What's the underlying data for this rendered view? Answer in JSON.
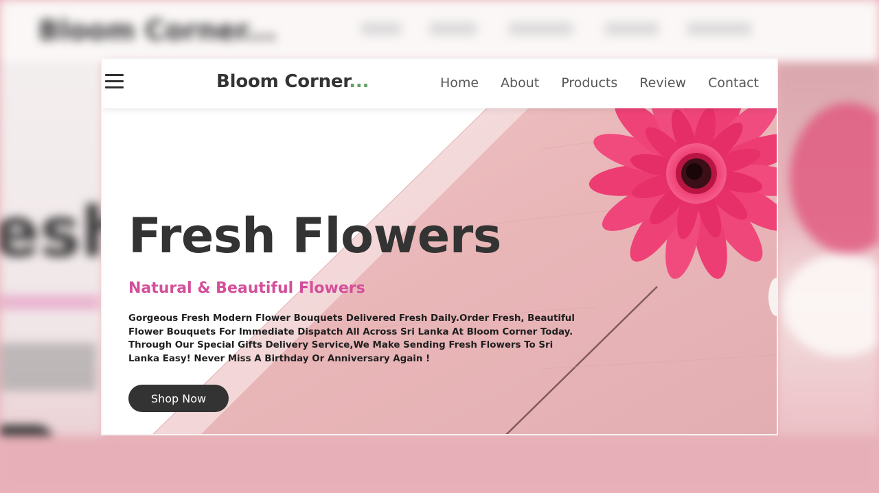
{
  "background": {
    "brand_text": "Bloom Corner..."
  },
  "header": {
    "brand_name": "Bloom Corner",
    "brand_suffix": "...",
    "nav": [
      {
        "label": "Home"
      },
      {
        "label": "About"
      },
      {
        "label": "Products"
      },
      {
        "label": "Review"
      },
      {
        "label": "Contact"
      }
    ],
    "menu_icon": "hamburger-icon"
  },
  "hero": {
    "title": "Fresh Flowers",
    "subtitle": "Natural & Beautiful Flowers",
    "description": "Gorgeous Fresh Modern Flower Bouquets Delivered Fresh Daily.Order Fresh, Beautiful Flower Bouquets For Immediate Dispatch All Across Sri Lanka At Bloom Corner Today. Through Our Special Gifts Delivery Service,We Make Sending Fresh Flowers To Sri Lanka Easy! Never Miss A Birthday Or Anniversary Again !",
    "cta_label": "Shop Now"
  },
  "colors": {
    "accent": "#d34f9a",
    "brand_dots": "#5f9f62",
    "dark": "#333333",
    "wood_pink": "#e9b7b8",
    "flower": "#f0457a"
  }
}
